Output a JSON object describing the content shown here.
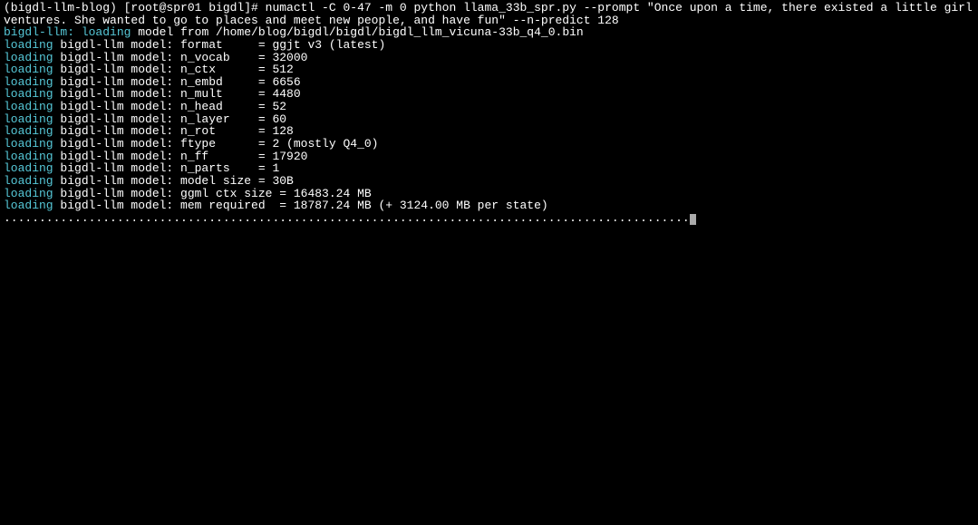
{
  "lines": [
    {
      "segments": [
        {
          "class": "white",
          "text": "(bigdl-llm-blog) [root@spr01 bigdl]# numactl -C 0-47 -m 0 python llama_33b_spr.py --prompt \"Once upon a time, there existed a little girl who liked to have ad"
        }
      ]
    },
    {
      "segments": [
        {
          "class": "white",
          "text": "ventures. She wanted to go to places and meet new people, and have fun\" --n-predict 128"
        }
      ]
    },
    {
      "segments": [
        {
          "class": "cyan",
          "text": "bigdl-llm: loading"
        },
        {
          "class": "white",
          "text": " model from /home/blog/bigdl/bigdl/bigdl_llm_vicuna-33b_q4_0.bin"
        }
      ]
    },
    {
      "segments": [
        {
          "class": "cyan",
          "text": "loading"
        },
        {
          "class": "white",
          "text": " bigdl-llm model: format     = ggjt v3 (latest)"
        }
      ]
    },
    {
      "segments": [
        {
          "class": "cyan",
          "text": "loading"
        },
        {
          "class": "white",
          "text": " bigdl-llm model: n_vocab    = 32000"
        }
      ]
    },
    {
      "segments": [
        {
          "class": "cyan",
          "text": "loading"
        },
        {
          "class": "white",
          "text": " bigdl-llm model: n_ctx      = 512"
        }
      ]
    },
    {
      "segments": [
        {
          "class": "cyan",
          "text": "loading"
        },
        {
          "class": "white",
          "text": " bigdl-llm model: n_embd     = 6656"
        }
      ]
    },
    {
      "segments": [
        {
          "class": "cyan",
          "text": "loading"
        },
        {
          "class": "white",
          "text": " bigdl-llm model: n_mult     = 4480"
        }
      ]
    },
    {
      "segments": [
        {
          "class": "cyan",
          "text": "loading"
        },
        {
          "class": "white",
          "text": " bigdl-llm model: n_head     = 52"
        }
      ]
    },
    {
      "segments": [
        {
          "class": "cyan",
          "text": "loading"
        },
        {
          "class": "white",
          "text": " bigdl-llm model: n_layer    = 60"
        }
      ]
    },
    {
      "segments": [
        {
          "class": "cyan",
          "text": "loading"
        },
        {
          "class": "white",
          "text": " bigdl-llm model: n_rot      = 128"
        }
      ]
    },
    {
      "segments": [
        {
          "class": "cyan",
          "text": "loading"
        },
        {
          "class": "white",
          "text": " bigdl-llm model: ftype      = 2 (mostly Q4_0)"
        }
      ]
    },
    {
      "segments": [
        {
          "class": "cyan",
          "text": "loading"
        },
        {
          "class": "white",
          "text": " bigdl-llm model: n_ff       = 17920"
        }
      ]
    },
    {
      "segments": [
        {
          "class": "cyan",
          "text": "loading"
        },
        {
          "class": "white",
          "text": " bigdl-llm model: n_parts    = 1"
        }
      ]
    },
    {
      "segments": [
        {
          "class": "cyan",
          "text": "loading"
        },
        {
          "class": "white",
          "text": " bigdl-llm model: model size = 30B"
        }
      ]
    },
    {
      "segments": [
        {
          "class": "cyan",
          "text": "loading"
        },
        {
          "class": "white",
          "text": " bigdl-llm model: ggml ctx size = 16483.24 MB"
        }
      ]
    },
    {
      "segments": [
        {
          "class": "cyan",
          "text": "loading"
        },
        {
          "class": "white",
          "text": " bigdl-llm model: mem required  = 18787.24 MB (+ 3124.00 MB per state)"
        }
      ]
    },
    {
      "segments": [
        {
          "class": "white",
          "text": "................................................................................................."
        }
      ],
      "cursor": true
    }
  ]
}
